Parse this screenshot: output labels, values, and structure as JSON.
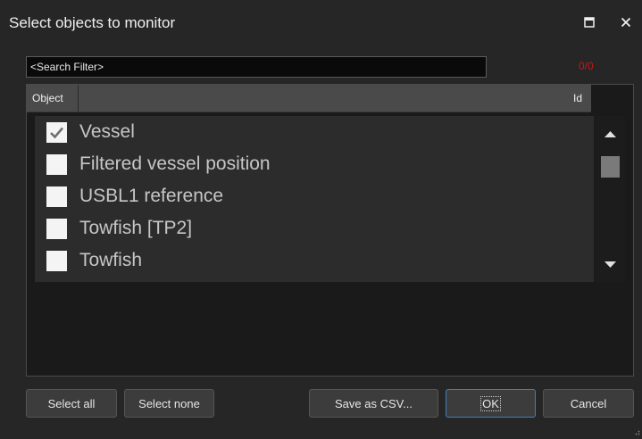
{
  "window": {
    "title": "Select objects to monitor",
    "maximize_icon": "maximize-icon",
    "close_icon": "close-icon"
  },
  "search": {
    "value": "<Search Filter>",
    "counter": "0/0"
  },
  "table": {
    "columns": [
      "Object",
      "Id"
    ],
    "rows": [
      {
        "label": "Vessel",
        "checked": true
      },
      {
        "label": "Filtered vessel position",
        "checked": false
      },
      {
        "label": "USBL1 reference",
        "checked": false
      },
      {
        "label": "Towfish [TP2]",
        "checked": false
      },
      {
        "label": "Towfish",
        "checked": false
      }
    ]
  },
  "buttons": {
    "select_all": "Select all",
    "select_none": "Select none",
    "save_csv": "Save as CSV...",
    "ok": "OK",
    "cancel": "Cancel"
  },
  "colors": {
    "background": "#262626",
    "counter": "#c51818",
    "ok_border": "#3b7fc4"
  }
}
